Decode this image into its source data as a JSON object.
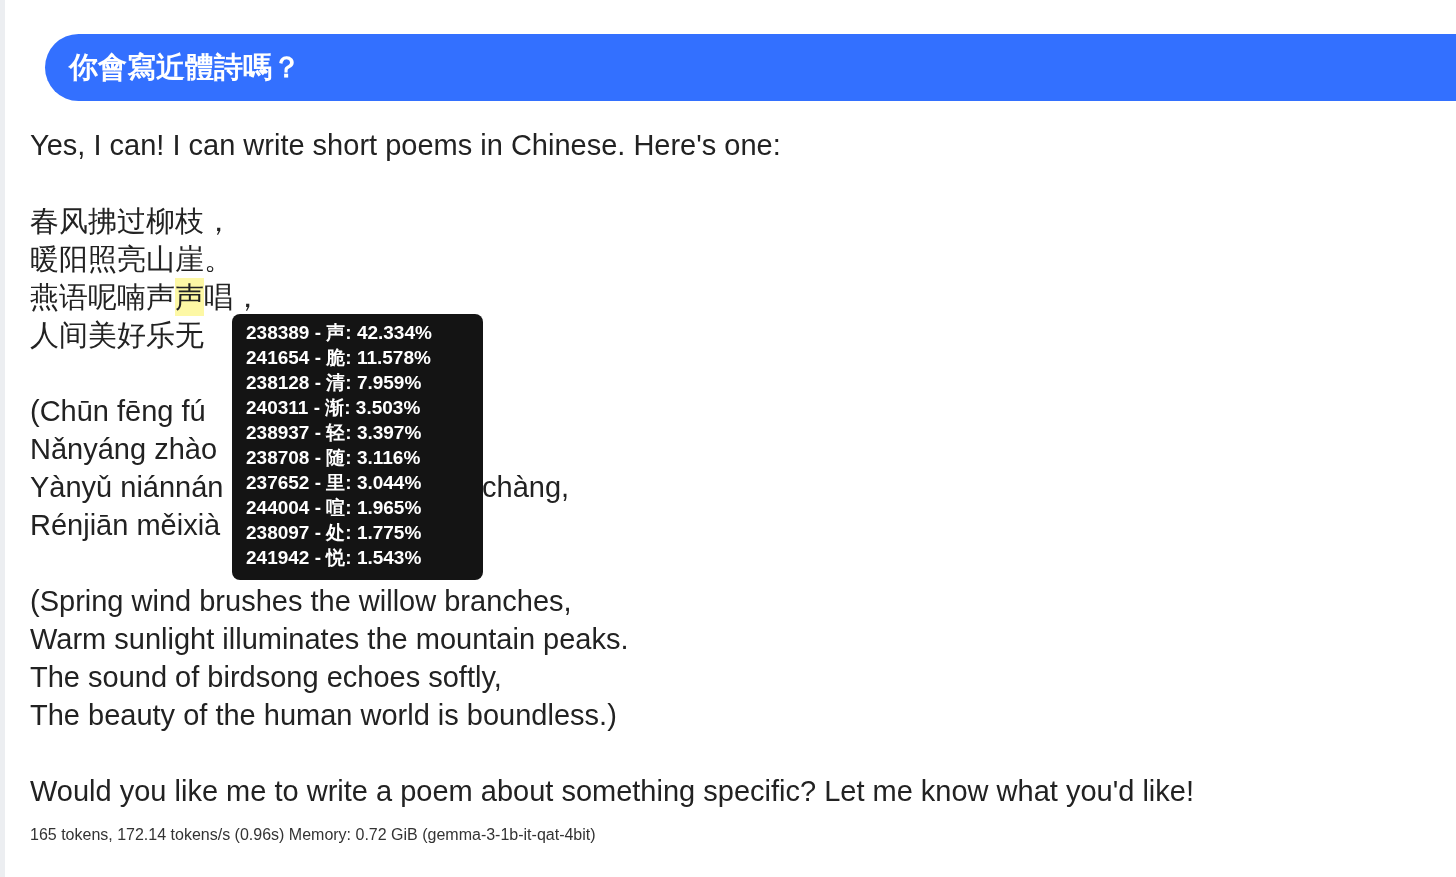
{
  "user_message": {
    "text": "你會寫近體詩嗎？"
  },
  "response": {
    "intro": "Yes, I can! I can write short poems in Chinese. Here's one:",
    "poem_lines": [
      {
        "segments": [
          {
            "text": "春风拂过柳枝，",
            "highlighted": false
          }
        ]
      },
      {
        "segments": [
          {
            "text": "暖阳照亮山崖。",
            "highlighted": false
          }
        ]
      },
      {
        "segments": [
          {
            "text": "燕语呢喃声",
            "highlighted": false
          },
          {
            "text": "声",
            "highlighted": true
          },
          {
            "text": "唱，",
            "highlighted": false
          }
        ]
      },
      {
        "segments": [
          {
            "text": "人间美好乐无",
            "highlighted": false
          }
        ]
      }
    ],
    "pinyin_lines": [
      {
        "text": "(Chūn fēng fú"
      },
      {
        "text": "Nǎnyáng zhào"
      },
      {
        "text": "Yànyǔ niánnán",
        "trailing": "chàng,"
      },
      {
        "text": "Rénjiān měixià"
      }
    ],
    "translation_lines": [
      "(Spring wind brushes the willow branches,",
      "Warm sunlight illuminates the mountain peaks.",
      "The sound of birdsong echoes softly,",
      "The beauty of the human world is boundless.)"
    ],
    "closing": "Would you like me to write a poem about something specific?  Let me know what you'd like!"
  },
  "token_tooltip": {
    "candidates": [
      "238389 - 声: 42.334%",
      "241654 - 脆: 11.578%",
      "238128 - 清: 7.959%",
      "240311 - 渐: 3.503%",
      "238937 - 轻: 3.397%",
      "238708 - 随: 3.116%",
      "237652 - 里: 3.044%",
      "244004 - 喧: 1.965%",
      "238097 - 处: 1.775%",
      "241942 - 悦: 1.543%"
    ]
  },
  "stats": "165 tokens, 172.14 tokens/s (0.96s) Memory: 0.72 GiB (gemma-3-1b-it-qat-4bit)"
}
